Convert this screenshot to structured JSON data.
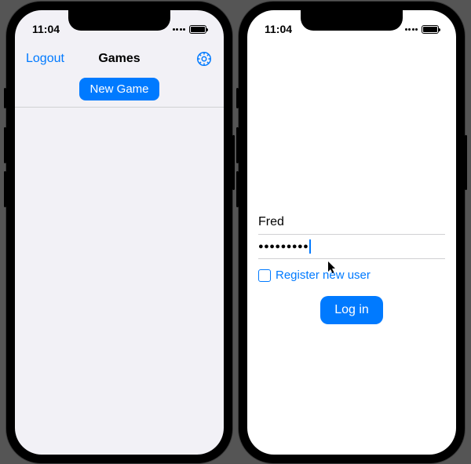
{
  "status": {
    "time": "11:04"
  },
  "left": {
    "nav_back": "Logout",
    "nav_title": "Games",
    "new_game": "New Game"
  },
  "right": {
    "username": "Fred",
    "password_masked": "●●●●●●●●●",
    "register_label": "Register new user",
    "login_button": "Log in"
  }
}
